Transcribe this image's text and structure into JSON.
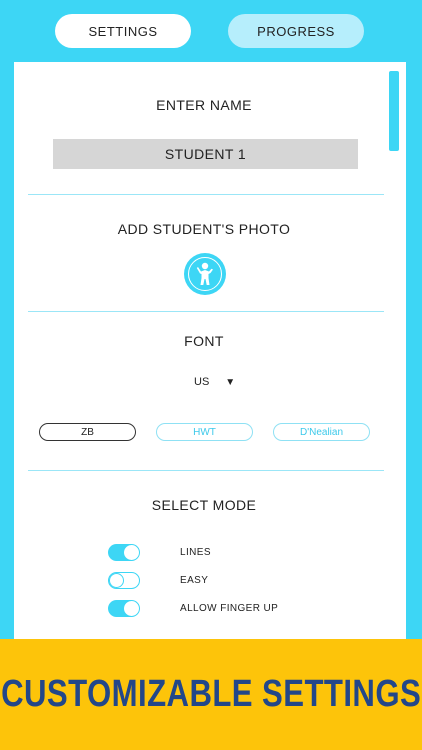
{
  "tabs": [
    {
      "label": "SETTINGS"
    },
    {
      "label": "PROGRESS"
    }
  ],
  "name_section": {
    "title": "ENTER NAME",
    "value": "STUDENT 1"
  },
  "photo_section": {
    "title": "ADD STUDENT'S PHOTO",
    "icon": "student-avatar-icon"
  },
  "font_section": {
    "title": "FONT",
    "region": "US",
    "options": [
      {
        "label": "ZB",
        "selected": true
      },
      {
        "label": "HWT",
        "selected": false
      },
      {
        "label": "D'Nealian",
        "selected": false
      }
    ]
  },
  "mode_section": {
    "title": "SELECT MODE",
    "modes": [
      {
        "label": "LINES",
        "on": true
      },
      {
        "label": "EASY",
        "on": false
      },
      {
        "label": "ALLOW FINGER UP",
        "on": true
      }
    ]
  },
  "banner": {
    "text": "CUSTOMIZABLE SETTINGS"
  },
  "colors": {
    "accent": "#3dd6f5",
    "banner_bg": "#fdc40a",
    "banner_text": "#234789"
  }
}
